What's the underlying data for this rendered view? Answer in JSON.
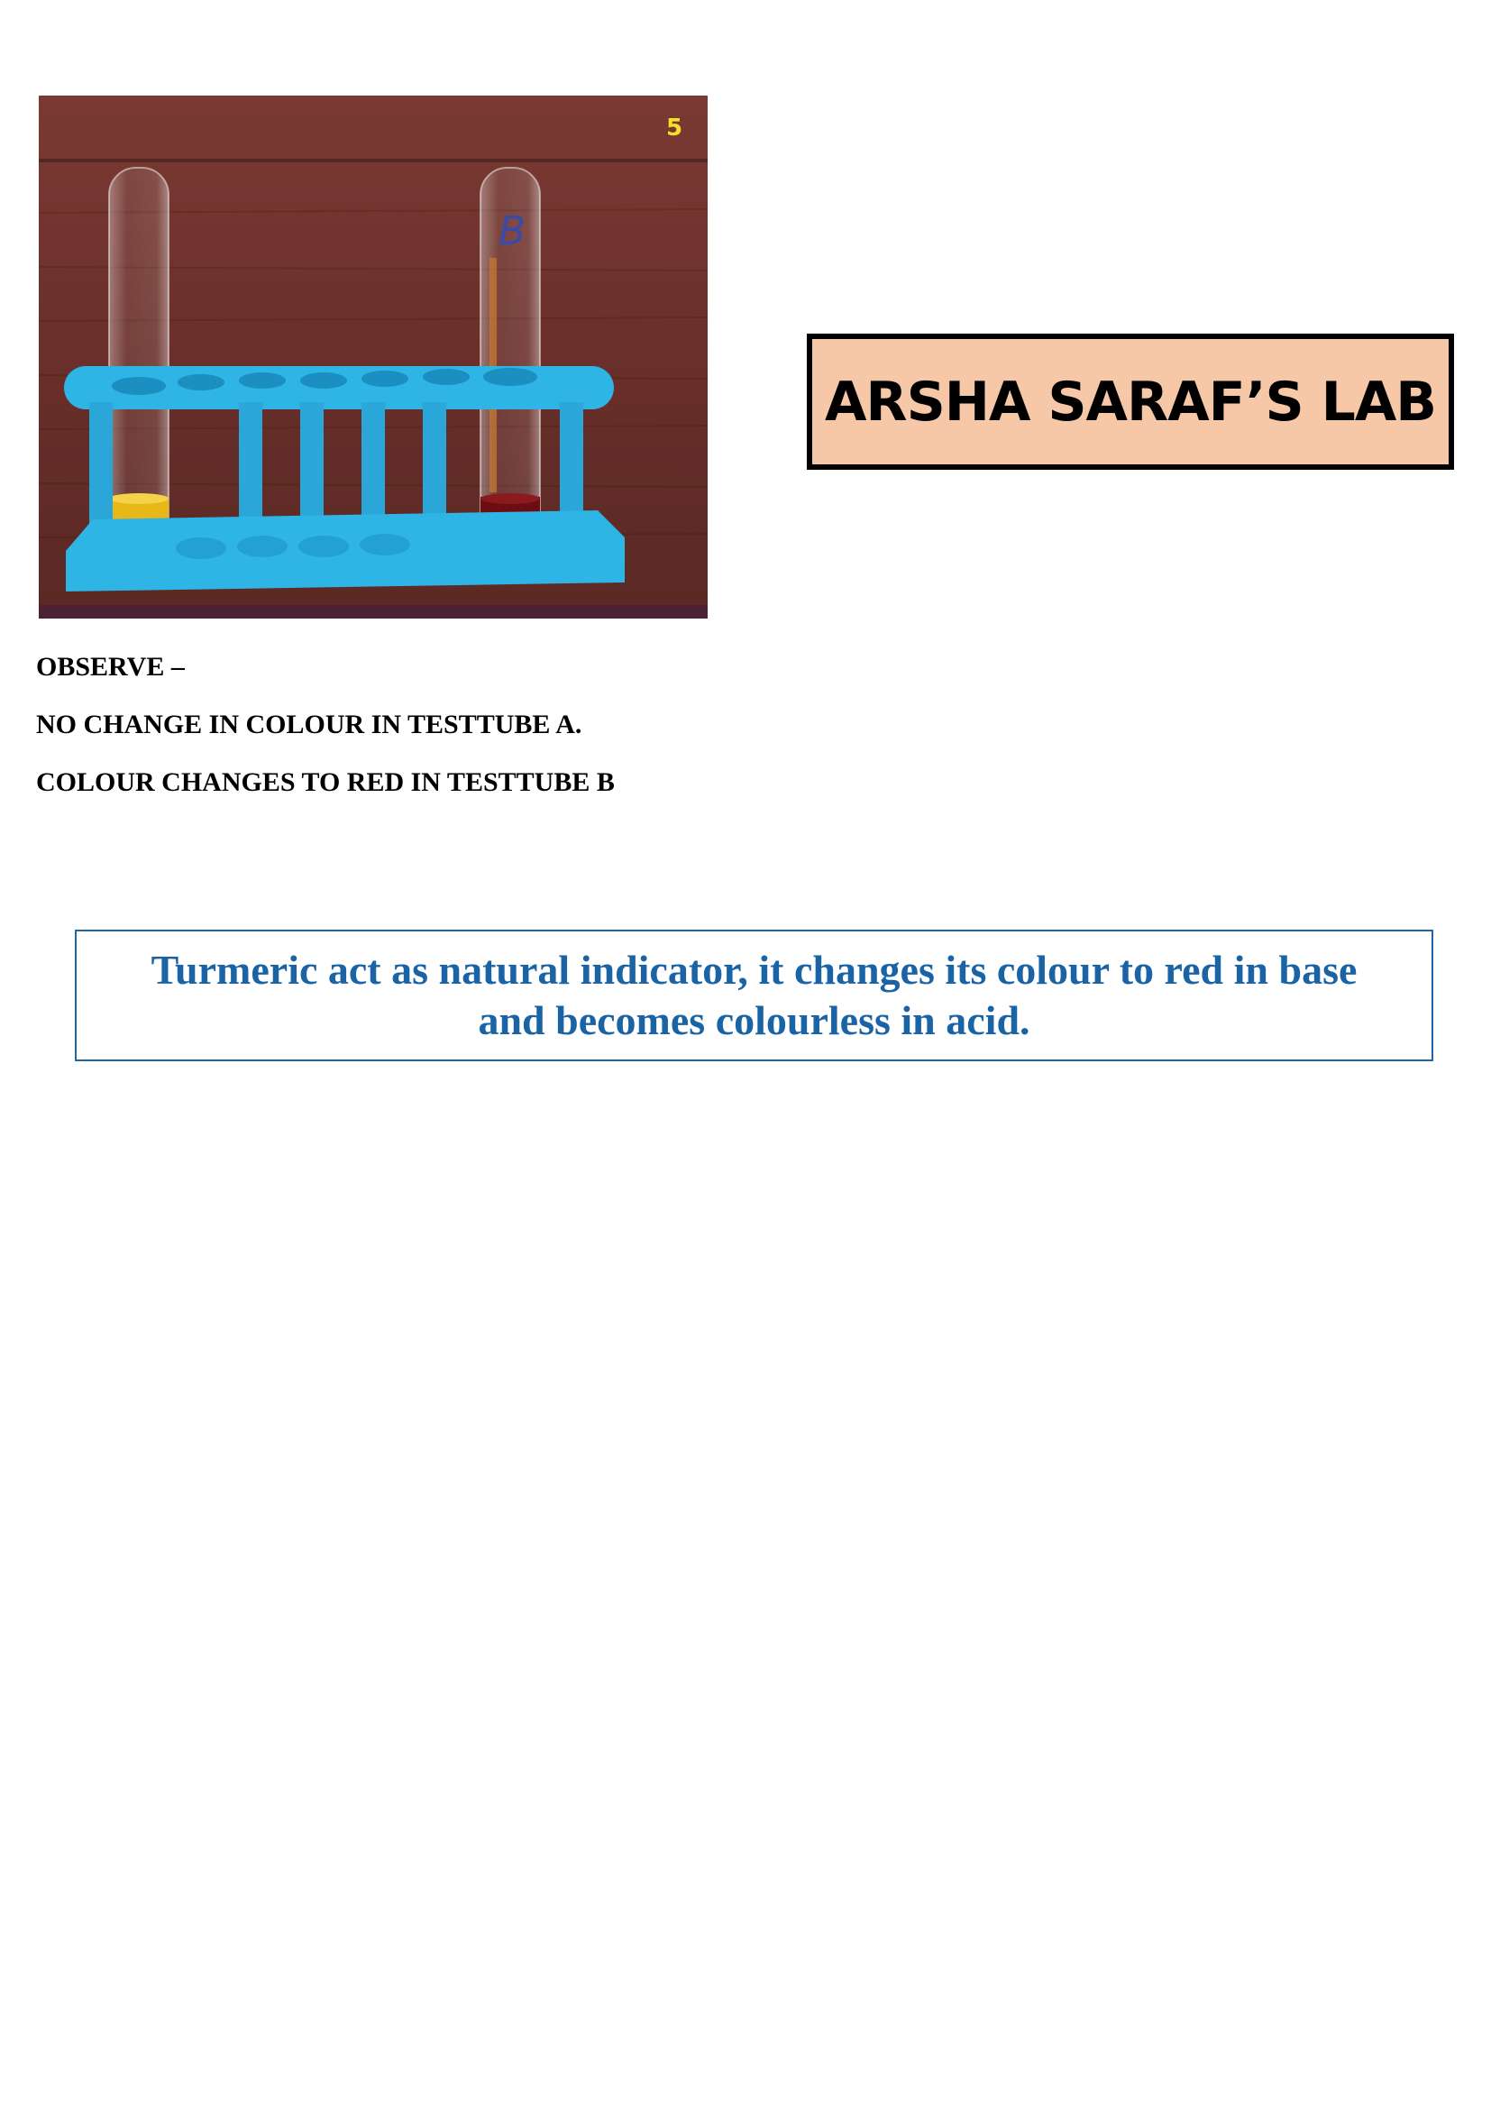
{
  "photo": {
    "description_icon": "test-tube-rack-photo",
    "tube_a_liquid_color": "#e8b818",
    "tube_b_liquid_color": "#6b0d12",
    "rack_color": "#2fb4e6",
    "background_color": "#6a2f2a",
    "slide_number": "5",
    "tube_b_mark": "B"
  },
  "lab_title": "ARSHA SARAF’S LAB",
  "observations": {
    "heading": "OBSERVE –",
    "line1": "NO CHANGE IN COLOUR IN TESTTUBE A.",
    "line2": "COLOUR CHANGES TO RED IN TESTTUBE B"
  },
  "conclusion": "Turmeric act as natural indicator, it changes its colour to red in base and becomes colourless in acid."
}
